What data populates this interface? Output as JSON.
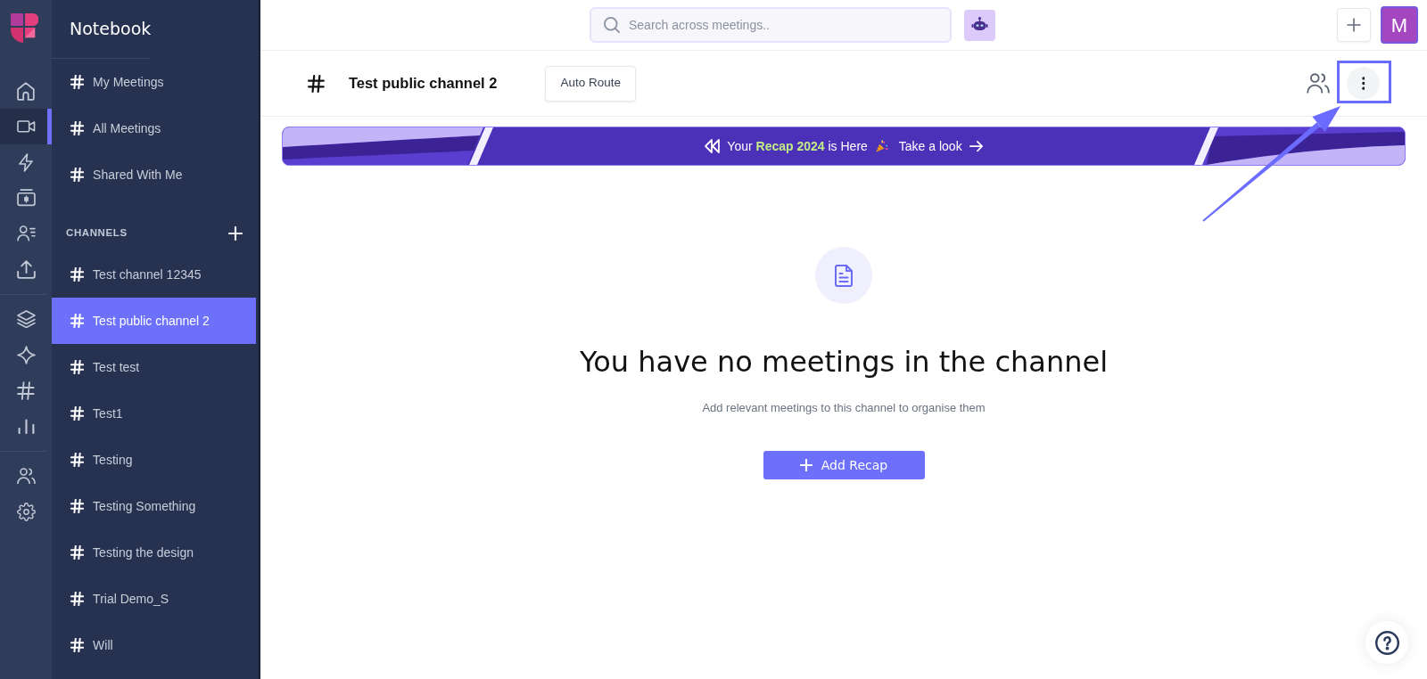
{
  "rail": {
    "groups": [
      {
        "items": [
          {
            "selected": false
          },
          {
            "selected": true
          },
          {
            "selected": false
          },
          {
            "selected": false
          },
          {
            "selected": false
          },
          {
            "selected": false
          }
        ]
      },
      {
        "items": [
          {
            "selected": false
          },
          {
            "selected": false
          },
          {
            "selected": false
          },
          {
            "selected": false
          }
        ]
      },
      {
        "items": [
          {
            "selected": false
          },
          {
            "selected": false
          }
        ]
      }
    ]
  },
  "sidebar": {
    "title": "Notebook",
    "views": [
      {
        "label": "My Meetings",
        "selected": false
      },
      {
        "label": "All Meetings",
        "selected": false
      },
      {
        "label": "Shared With Me",
        "selected": false
      }
    ],
    "channels_heading": "CHANNELS",
    "channels": [
      {
        "label": "Test channel 12345",
        "selected": false
      },
      {
        "label": "Test public channel 2",
        "selected": true
      },
      {
        "label": "Test test",
        "selected": false
      },
      {
        "label": "Test1",
        "selected": false
      },
      {
        "label": "Testing",
        "selected": false
      },
      {
        "label": "Testing Something",
        "selected": false
      },
      {
        "label": "Testing the design",
        "selected": false
      },
      {
        "label": "Trial Demo_S",
        "selected": false
      },
      {
        "label": "Will",
        "selected": false
      }
    ]
  },
  "topbar": {
    "search": {
      "placeholder": "Search across meetings.."
    },
    "avatar": "M"
  },
  "channel_header": {
    "title": "Test public channel 2",
    "route_button": "Auto Route"
  },
  "banner": {
    "text": "Your **Recap 2024** is Here",
    "link": "Take a look"
  },
  "empty_state": {
    "heading": "You have no meetings in the channel",
    "message": "Add relevant meetings to this channel to organise them",
    "button": "Add Recap"
  }
}
